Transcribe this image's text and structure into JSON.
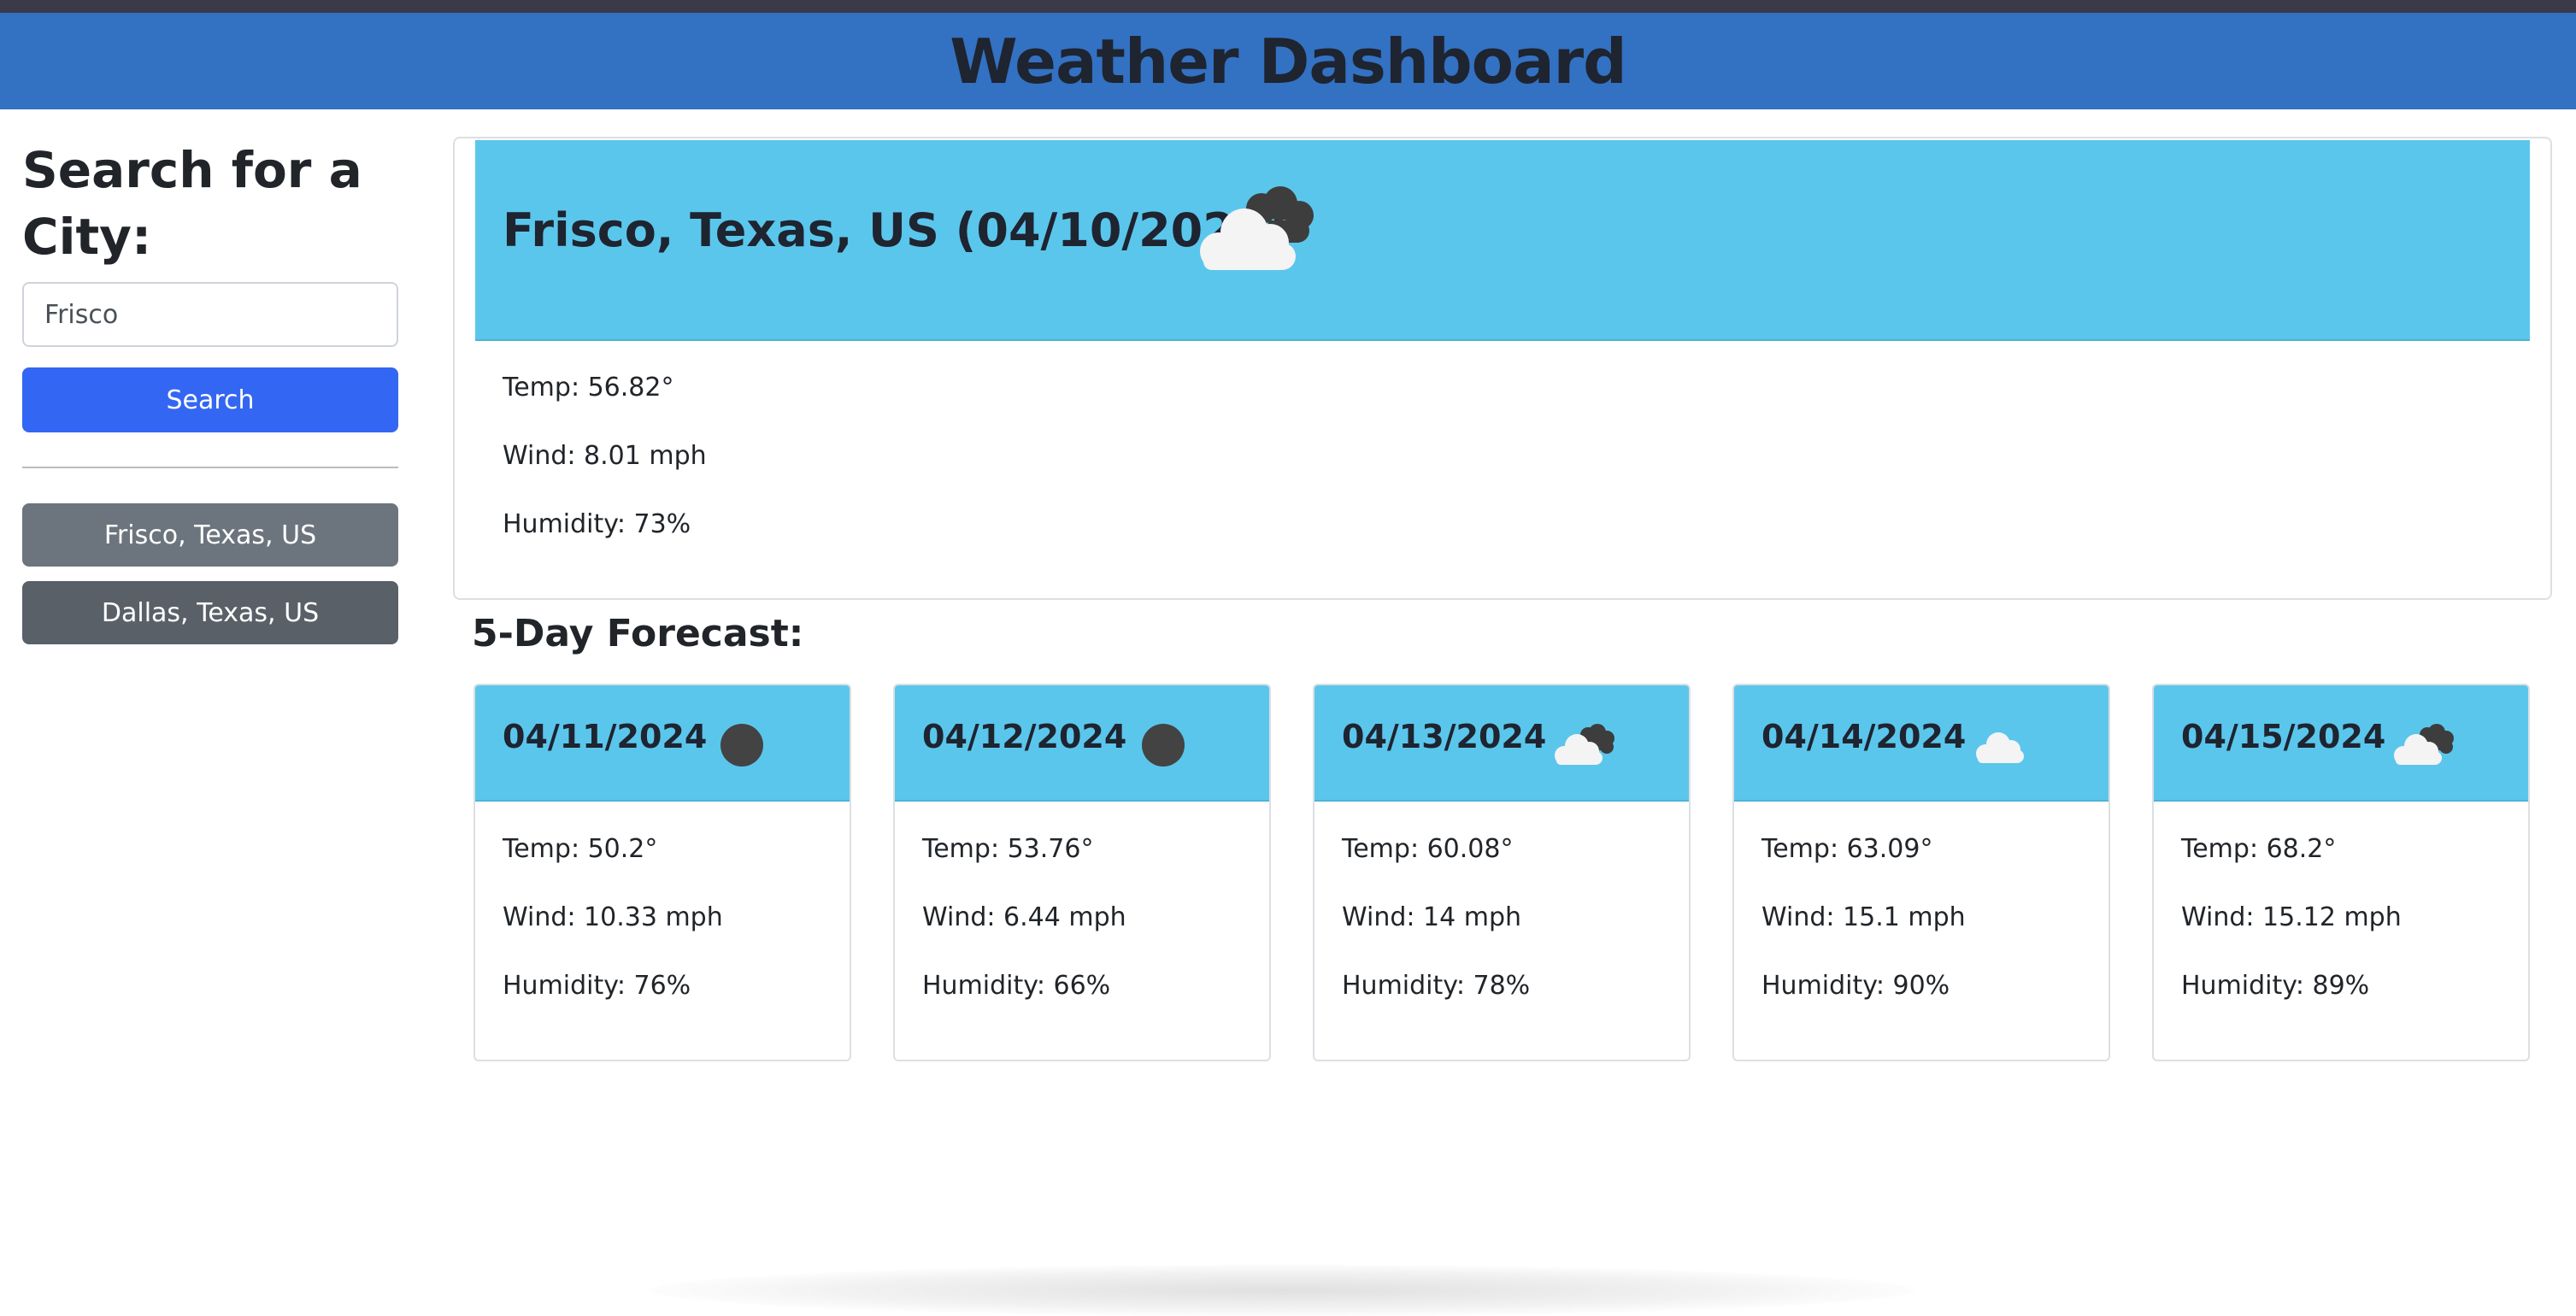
{
  "header": {
    "title": "Weather Dashboard"
  },
  "sidebar": {
    "heading": "Search for a City:",
    "search_value": "Frisco",
    "search_button": "Search",
    "history": [
      "Frisco, Texas, US",
      "Dallas, Texas, US"
    ]
  },
  "current": {
    "title": "Frisco, Texas, US (04/10/2024)",
    "icon": "broken-clouds-icon",
    "temp": "Temp: 56.82°",
    "wind": "Wind: 8.01 mph",
    "humidity": "Humidity: 73%"
  },
  "forecast": {
    "title": "5-Day Forecast:",
    "days": [
      {
        "date": "04/11/2024",
        "icon": "dark-circle-icon",
        "temp": "Temp: 50.2°",
        "wind": "Wind: 10.33 mph",
        "humidity": "Humidity: 76%"
      },
      {
        "date": "04/12/2024",
        "icon": "dark-circle-icon",
        "temp": "Temp: 53.76°",
        "wind": "Wind: 6.44 mph",
        "humidity": "Humidity: 66%"
      },
      {
        "date": "04/13/2024",
        "icon": "broken-clouds-icon",
        "temp": "Temp: 60.08°",
        "wind": "Wind: 14 mph",
        "humidity": "Humidity: 78%"
      },
      {
        "date": "04/14/2024",
        "icon": "cloud-icon",
        "temp": "Temp: 63.09°",
        "wind": "Wind: 15.1 mph",
        "humidity": "Humidity: 90%"
      },
      {
        "date": "04/15/2024",
        "icon": "broken-clouds-icon",
        "temp": "Temp: 68.2°",
        "wind": "Wind: 15.12 mph",
        "humidity": "Humidity: 89%"
      }
    ]
  },
  "colors": {
    "header_bg": "#3371c2",
    "card_header_bg": "#5bc6ec",
    "search_button_bg": "#3366f2",
    "history_button_bg": "#6c757d"
  }
}
